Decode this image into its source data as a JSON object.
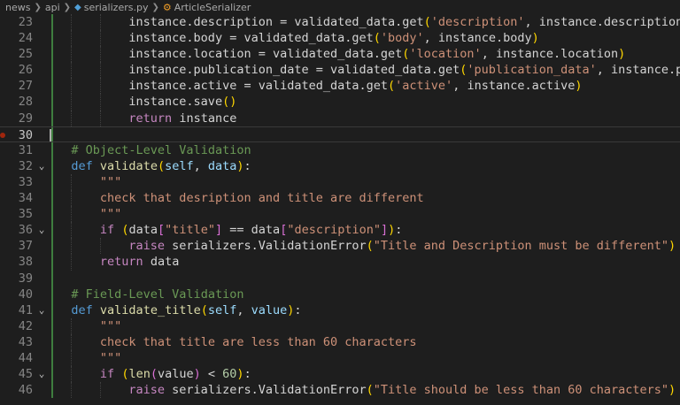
{
  "breadcrumb": {
    "items": [
      "news",
      "api",
      "serializers.py",
      "ArticleSerializer"
    ],
    "separator": ">"
  },
  "editor": {
    "current_line": 30,
    "lines": [
      {
        "num": "23",
        "indent": 3,
        "fold": "",
        "tokens": [
          [
            "w",
            "instance.description = validated_data.get"
          ],
          [
            "b1",
            "("
          ],
          [
            "s",
            "'description'"
          ],
          [
            "w",
            ", instance.description"
          ],
          [
            "b1",
            ")"
          ]
        ]
      },
      {
        "num": "24",
        "indent": 3,
        "fold": "",
        "tokens": [
          [
            "w",
            "instance.body = validated_data.get"
          ],
          [
            "b1",
            "("
          ],
          [
            "s",
            "'body'"
          ],
          [
            "w",
            ", instance.body"
          ],
          [
            "b1",
            ")"
          ]
        ]
      },
      {
        "num": "25",
        "indent": 3,
        "fold": "",
        "tokens": [
          [
            "w",
            "instance.location = validated_data.get"
          ],
          [
            "b1",
            "("
          ],
          [
            "s",
            "'location'"
          ],
          [
            "w",
            ", instance.location"
          ],
          [
            "b1",
            ")"
          ]
        ]
      },
      {
        "num": "26",
        "indent": 3,
        "fold": "",
        "tokens": [
          [
            "w",
            "instance.publication_date = validated_data.get"
          ],
          [
            "b1",
            "("
          ],
          [
            "s",
            "'publication_data'"
          ],
          [
            "w",
            ", instance.publica"
          ]
        ]
      },
      {
        "num": "27",
        "indent": 3,
        "fold": "",
        "tokens": [
          [
            "w",
            "instance.active = validated_data.get"
          ],
          [
            "b1",
            "("
          ],
          [
            "s",
            "'active'"
          ],
          [
            "w",
            ", instance.active"
          ],
          [
            "b1",
            ")"
          ]
        ]
      },
      {
        "num": "28",
        "indent": 3,
        "fold": "",
        "tokens": [
          [
            "w",
            "instance.save"
          ],
          [
            "b1",
            "()"
          ]
        ]
      },
      {
        "num": "29",
        "indent": 3,
        "fold": "",
        "tokens": [
          [
            "kc",
            "return"
          ],
          [
            "w",
            " instance"
          ]
        ]
      },
      {
        "num": "30",
        "indent": 0,
        "fold": "",
        "tokens": []
      },
      {
        "num": "31",
        "indent": 1,
        "fold": "",
        "tokens": [
          [
            "c",
            "# Object-Level Validation"
          ]
        ]
      },
      {
        "num": "32",
        "indent": 1,
        "fold": "v",
        "tokens": [
          [
            "k",
            "def"
          ],
          [
            "w",
            " "
          ],
          [
            "fn",
            "validate"
          ],
          [
            "b1",
            "("
          ],
          [
            "p",
            "self"
          ],
          [
            "w",
            ", "
          ],
          [
            "p",
            "data"
          ],
          [
            "b1",
            ")"
          ],
          [
            "w",
            ":"
          ]
        ]
      },
      {
        "num": "33",
        "indent": 2,
        "fold": "",
        "tokens": [
          [
            "s",
            "\"\"\""
          ]
        ]
      },
      {
        "num": "34",
        "indent": 2,
        "fold": "",
        "tokens": [
          [
            "s",
            "check that desription and title are different"
          ]
        ]
      },
      {
        "num": "35",
        "indent": 2,
        "fold": "",
        "tokens": [
          [
            "s",
            "\"\"\""
          ]
        ]
      },
      {
        "num": "36",
        "indent": 2,
        "fold": "v",
        "tokens": [
          [
            "kc",
            "if"
          ],
          [
            "w",
            " "
          ],
          [
            "b1",
            "("
          ],
          [
            "w",
            "data"
          ],
          [
            "b2",
            "["
          ],
          [
            "s",
            "\"title\""
          ],
          [
            "b2",
            "]"
          ],
          [
            "w",
            " == data"
          ],
          [
            "b2",
            "["
          ],
          [
            "s",
            "\"description\""
          ],
          [
            "b2",
            "]"
          ],
          [
            "b1",
            ")"
          ],
          [
            "w",
            ":"
          ]
        ]
      },
      {
        "num": "37",
        "indent": 3,
        "fold": "",
        "tokens": [
          [
            "kc",
            "raise"
          ],
          [
            "w",
            " serializers.ValidationError"
          ],
          [
            "b1",
            "("
          ],
          [
            "s",
            "\"Title and Description must be different\""
          ],
          [
            "b1",
            ")"
          ]
        ]
      },
      {
        "num": "38",
        "indent": 2,
        "fold": "",
        "tokens": [
          [
            "kc",
            "return"
          ],
          [
            "w",
            " data"
          ]
        ]
      },
      {
        "num": "39",
        "indent": 1,
        "fold": "",
        "tokens": []
      },
      {
        "num": "40",
        "indent": 1,
        "fold": "",
        "tokens": [
          [
            "c",
            "# Field-Level Validation"
          ]
        ]
      },
      {
        "num": "41",
        "indent": 1,
        "fold": "v",
        "tokens": [
          [
            "k",
            "def"
          ],
          [
            "w",
            " "
          ],
          [
            "fn",
            "validate_title"
          ],
          [
            "b1",
            "("
          ],
          [
            "p",
            "self"
          ],
          [
            "w",
            ", "
          ],
          [
            "p",
            "value"
          ],
          [
            "b1",
            ")"
          ],
          [
            "w",
            ":"
          ]
        ]
      },
      {
        "num": "42",
        "indent": 2,
        "fold": "",
        "tokens": [
          [
            "s",
            "\"\"\""
          ]
        ]
      },
      {
        "num": "43",
        "indent": 2,
        "fold": "",
        "tokens": [
          [
            "s",
            "check that title are less than 60 characters"
          ]
        ]
      },
      {
        "num": "44",
        "indent": 2,
        "fold": "",
        "tokens": [
          [
            "s",
            "\"\"\""
          ]
        ]
      },
      {
        "num": "45",
        "indent": 2,
        "fold": "v",
        "tokens": [
          [
            "kc",
            "if"
          ],
          [
            "w",
            " "
          ],
          [
            "b1",
            "("
          ],
          [
            "fn",
            "len"
          ],
          [
            "b2",
            "("
          ],
          [
            "w",
            "value"
          ],
          [
            "b2",
            ")"
          ],
          [
            "w",
            " < "
          ],
          [
            "n",
            "60"
          ],
          [
            "b1",
            ")"
          ],
          [
            "w",
            ":"
          ]
        ]
      },
      {
        "num": "46",
        "indent": 3,
        "fold": "",
        "tokens": [
          [
            "kc",
            "raise"
          ],
          [
            "w",
            " serializers.ValidationError"
          ],
          [
            "b1",
            "("
          ],
          [
            "s",
            "\"Title should be less than 60 characters\""
          ],
          [
            "b1",
            ")"
          ]
        ]
      }
    ]
  }
}
